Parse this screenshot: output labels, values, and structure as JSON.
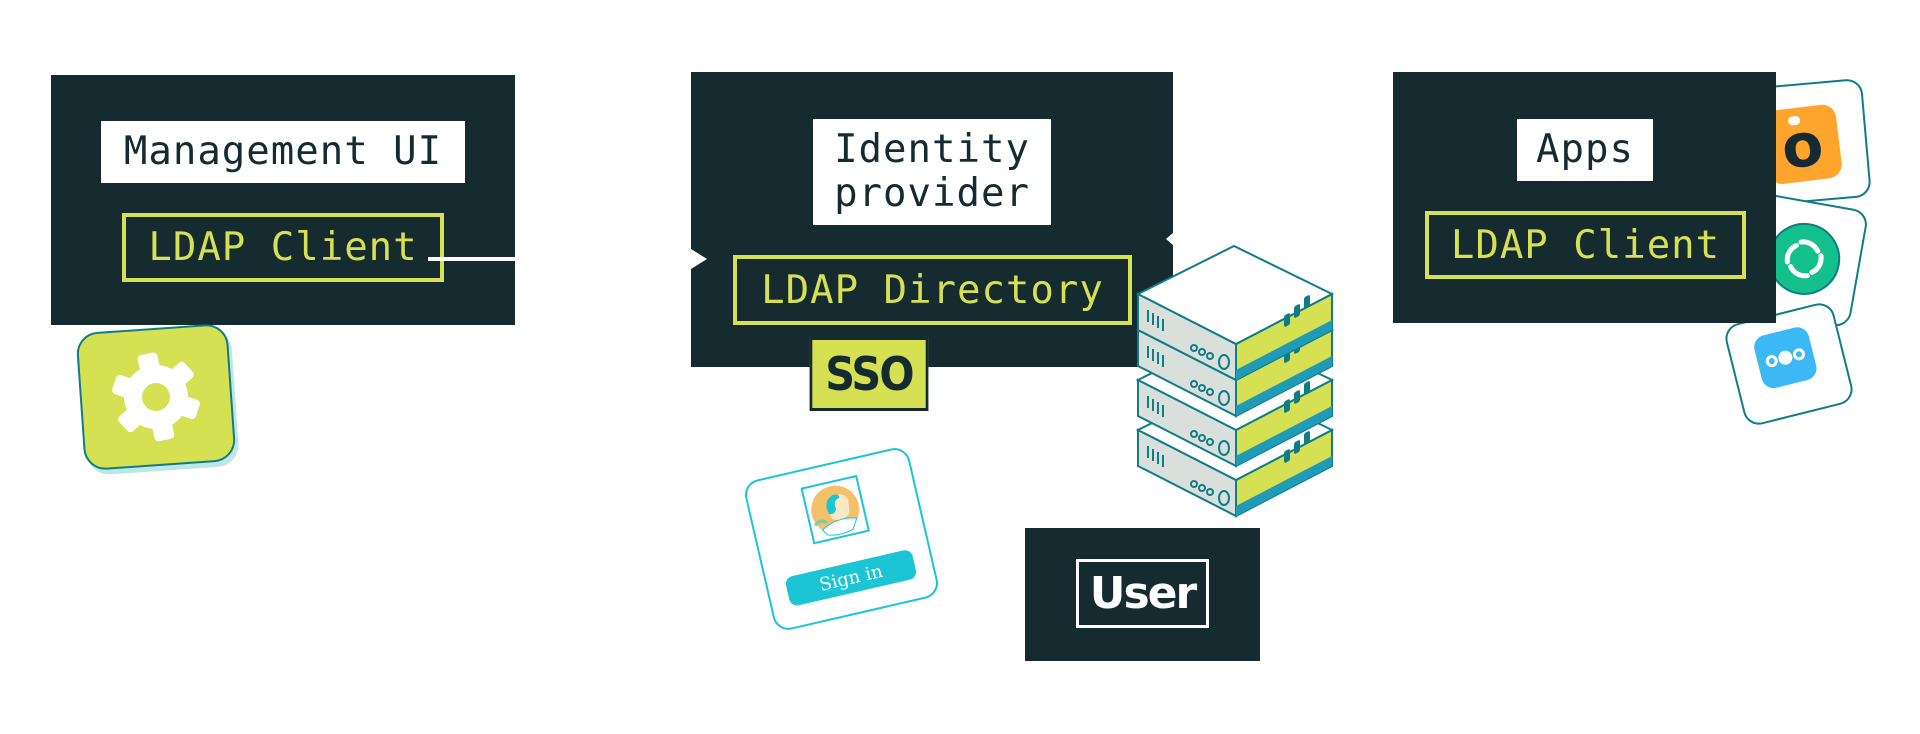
{
  "colors": {
    "panel": "#152b30",
    "lime": "#d5e052",
    "white": "#ffffff",
    "teal_outline": "#0f7c86",
    "cyan": "#1cc5d4",
    "server_grey": "#d9dfdb",
    "server_blue": "#1f9bb8",
    "orange_app": "#ffa52e",
    "green_app": "#13bf8a",
    "blue_app": "#3cb9f5",
    "avatar_orange": "#f4c06a"
  },
  "management": {
    "title": "Management UI",
    "client_label": "LDAP Client",
    "icon": "gear-icon"
  },
  "identity_provider": {
    "title": "Identity\nprovider",
    "directory_label": "LDAP Directory",
    "badge": "SSO",
    "signin": {
      "button_label": "Sign in",
      "avatar_icon": "user-avatar-illustration"
    },
    "server_icon": "server-stack-icon"
  },
  "user": {
    "label": "User"
  },
  "apps": {
    "title": "Apps",
    "client_label": "LDAP Client",
    "icons": [
      {
        "name": "orange-o-app-icon",
        "glyph": "o"
      },
      {
        "name": "element-app-icon",
        "glyph": ""
      },
      {
        "name": "nextcloud-app-icon",
        "glyph": ""
      }
    ]
  }
}
